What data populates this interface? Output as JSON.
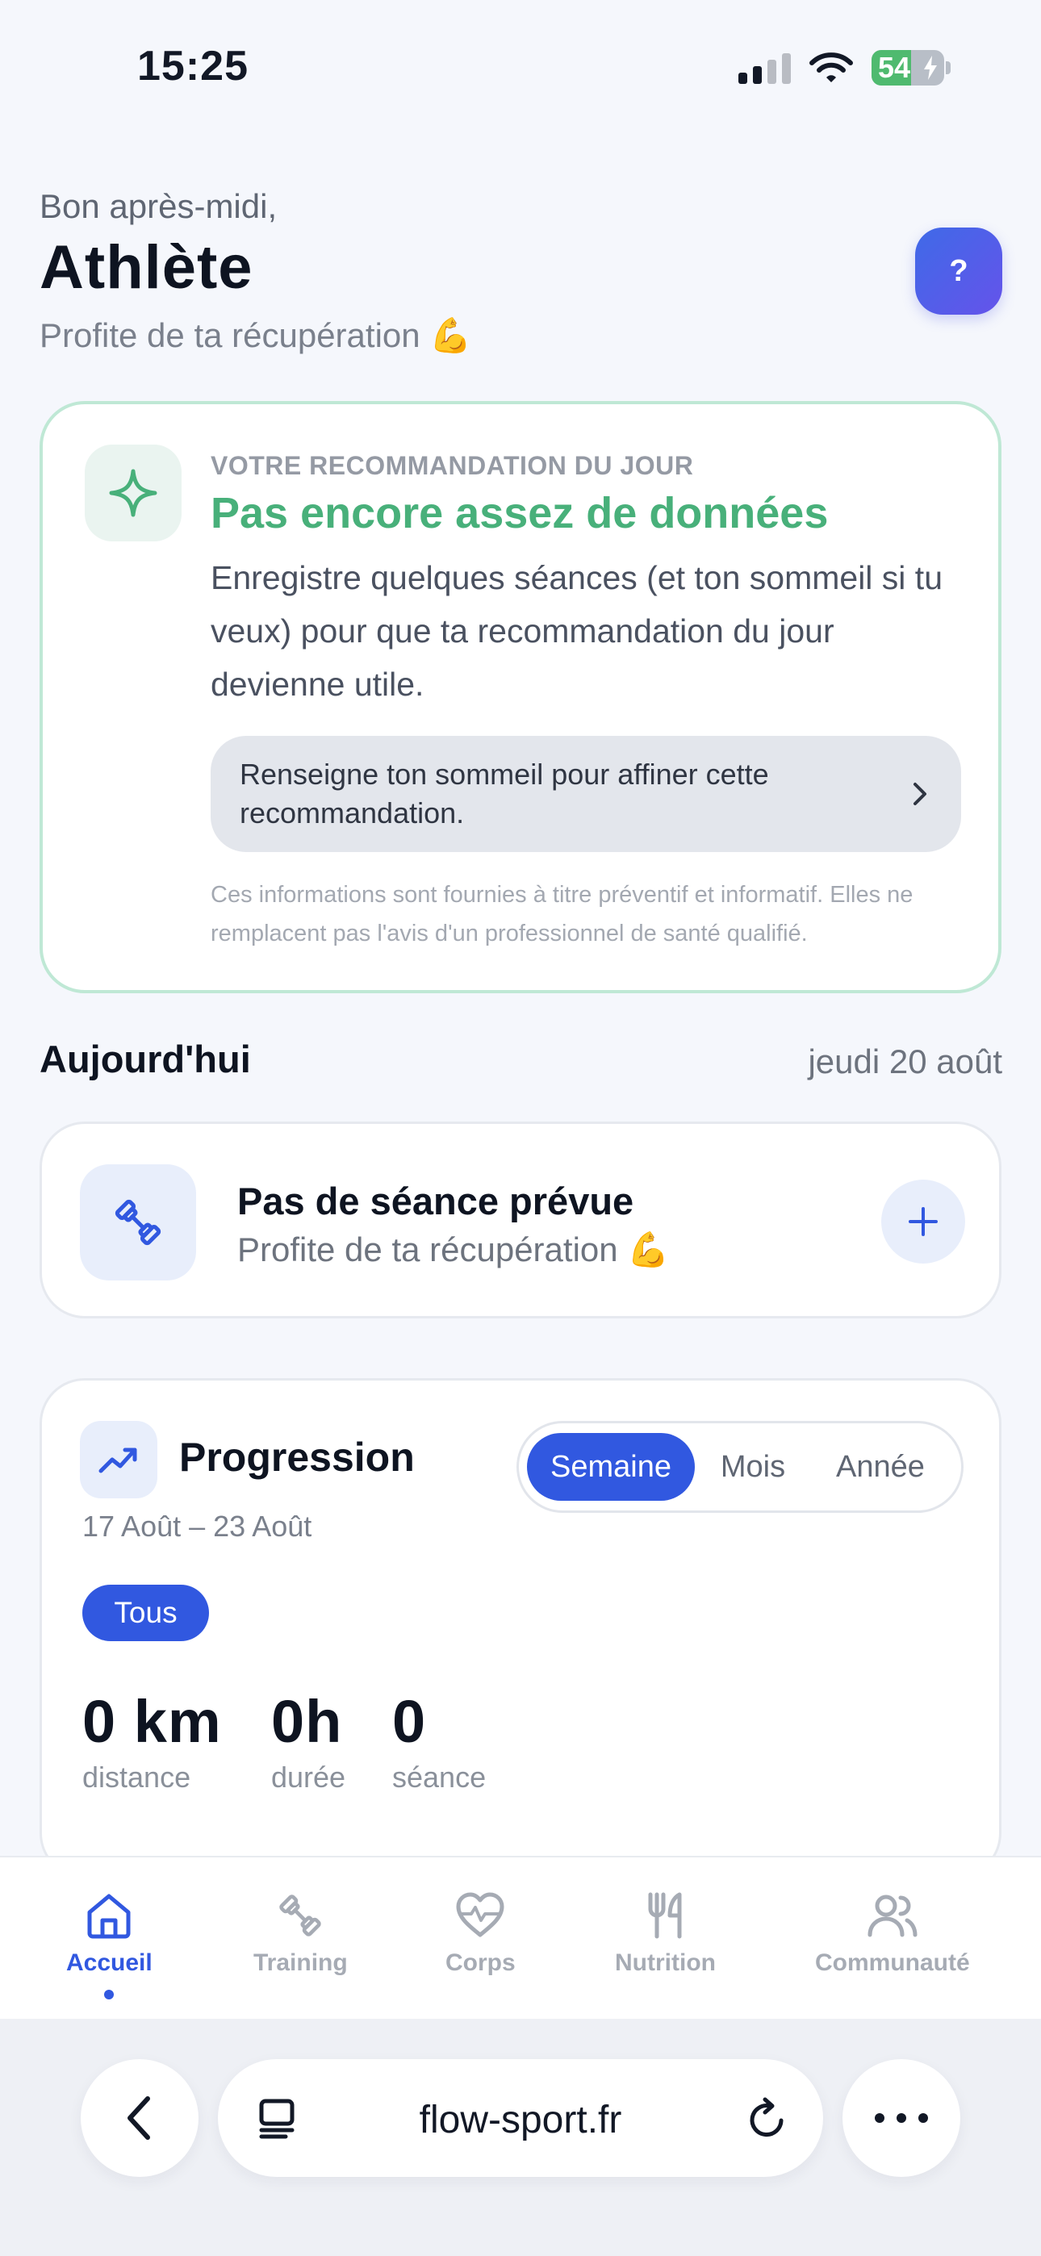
{
  "status_bar": {
    "time": "15:25",
    "battery": "54",
    "battery_level": 0.54
  },
  "header": {
    "greeting": "Bon après-midi,",
    "name": "Athlète",
    "subtitle": "Profite de ta récupération 💪",
    "help_label": "?"
  },
  "recommendation": {
    "eyebrow": "VOTRE RECOMMANDATION DU JOUR",
    "title": "Pas encore assez de données",
    "body": "Enregistre quelques séances (et ton sommeil si tu veux) pour que ta recommandation du jour devienne utile.",
    "action_label": "Renseigne ton sommeil pour affiner cette recommandation.",
    "disclaimer": "Ces informations sont fournies à titre préventif et informatif. Elles ne remplacent pas l'avis d'un professionnel de santé qualifié.",
    "accent": "#48b07a"
  },
  "today": {
    "title": "Aujourd'hui",
    "date": "jeudi 20 août",
    "session_title": "Pas de séance prévue",
    "session_subtitle": "Profite de ta récupération 💪"
  },
  "progression": {
    "title": "Progression",
    "range": "17 Août – 23 Août",
    "periods": [
      "Semaine",
      "Mois",
      "Année"
    ],
    "active_period": "Semaine",
    "filter": "Tous",
    "stats": [
      {
        "value": "0 km",
        "label": "distance"
      },
      {
        "value": "0h",
        "label": "durée"
      },
      {
        "value": "0",
        "label": "séance"
      }
    ]
  },
  "tab_bar": {
    "items": [
      {
        "label": "Accueil",
        "icon": "home-icon",
        "active": true
      },
      {
        "label": "Training",
        "icon": "dumbbell-icon",
        "active": false
      },
      {
        "label": "Corps",
        "icon": "heart-pulse-icon",
        "active": false
      },
      {
        "label": "Nutrition",
        "icon": "fork-knife-icon",
        "active": false
      },
      {
        "label": "Communauté",
        "icon": "users-icon",
        "active": false
      }
    ],
    "active_color": "#3158e0"
  },
  "browser": {
    "url": "flow-sport.fr"
  }
}
